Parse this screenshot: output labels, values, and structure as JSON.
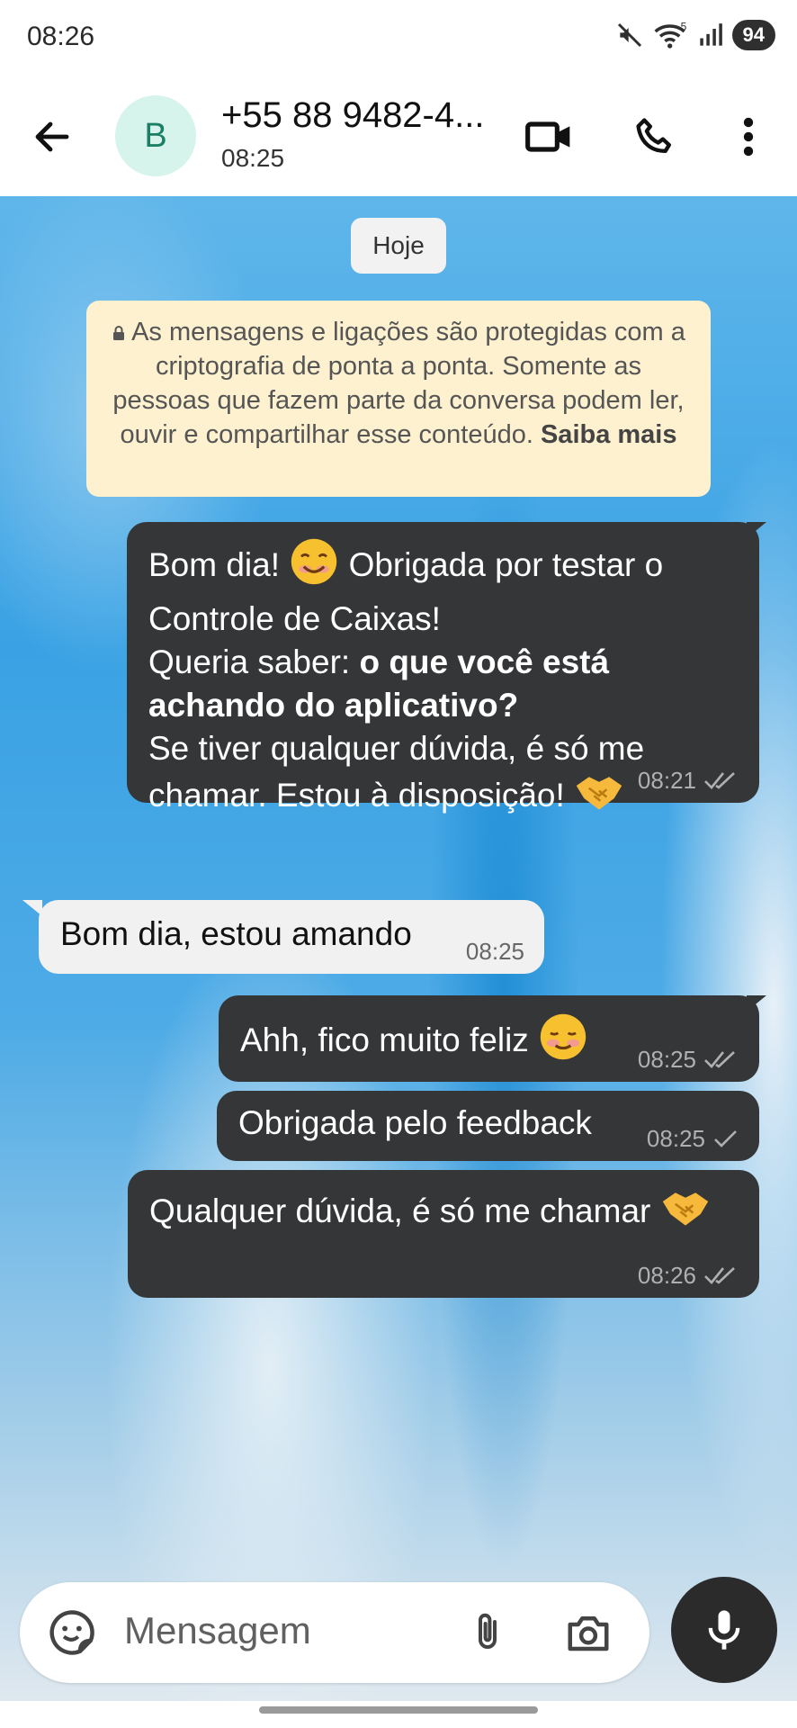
{
  "status_bar": {
    "time": "08:26",
    "wifi_badge": "5",
    "battery": "94"
  },
  "header": {
    "avatar_letter": "B",
    "contact_name": "+55 88 9482-4...",
    "contact_subtitle": "08:25",
    "icons": [
      "back-arrow-icon",
      "video-call-icon",
      "voice-call-icon",
      "more-options-icon"
    ]
  },
  "chat": {
    "date_chip": "Hoje",
    "encryption_notice": {
      "text": "As mensagens e ligações são protegidas com a criptografia de ponta a ponta. Somente as pessoas que fazem parte da conversa podem ler, ouvir e compartilhar esse conteúdo.",
      "link": "Saiba mais"
    },
    "messages": [
      {
        "direction": "out",
        "lines": {
          "l1": "Bom dia! ",
          "l1b": " Obrigada por testar o",
          "l2": "Controle de Caixas!",
          "l3": "Queria saber: ",
          "l3b": "o que você está",
          "l4": "achando do aplicativo?",
          "l5": "Se tiver qualquer dúvida, é só me",
          "l6": "chamar. Estou à disposição! "
        },
        "time": "08:21",
        "status": "double-check-icon"
      },
      {
        "direction": "in",
        "text": "Bom dia, estou amando",
        "time": "08:25"
      },
      {
        "direction": "out",
        "text": "Ahh, fico muito feliz ",
        "time": "08:25",
        "status": "double-check-icon"
      },
      {
        "direction": "out",
        "text": "Obrigada pelo feedback",
        "time": "08:25",
        "status": "single-check-icon"
      },
      {
        "direction": "out",
        "text": "Qualquer dúvida, é só me chamar ",
        "time": "08:26",
        "status": "double-check-icon"
      }
    ]
  },
  "input": {
    "placeholder": "Mensagem"
  },
  "colors": {
    "outgoing_bubble": "#353638",
    "incoming_bubble": "#f1f1f1",
    "notice_bg": "#fdf1cf",
    "avatar_bg": "#d6f3ec"
  }
}
